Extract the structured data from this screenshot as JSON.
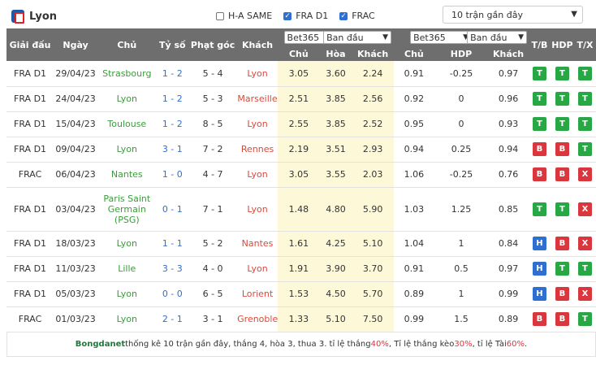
{
  "team": {
    "name": "Lyon"
  },
  "filters": [
    {
      "label": "H-A SAME",
      "checked": false
    },
    {
      "label": "FRA D1",
      "checked": true
    },
    {
      "label": "FRAC",
      "checked": true
    }
  ],
  "recent_select": {
    "value": "10 trận gần đây"
  },
  "headers": {
    "league": "Giải đấu",
    "date": "Ngày",
    "home": "Chủ",
    "score": "Tỷ số",
    "corners": "Phạt góc",
    "away": "Khách",
    "bookmaker1": "Bet365",
    "type1": "Ban đầu",
    "bookmaker2": "Bet365",
    "type2": "Ban đầu",
    "tb": "T/B",
    "hdp": "HDP",
    "tx": "T/X",
    "sub": [
      "Chủ",
      "Hòa",
      "Khách",
      "Chủ",
      "HDP",
      "Khách"
    ]
  },
  "matches": [
    {
      "league": "FRA D1",
      "date": "29/04/23",
      "home": "Strasbourg",
      "score": "1 - 2",
      "corners": "5 - 4",
      "away": "Lyon",
      "o_home": "3.05",
      "o_draw": "3.60",
      "o_away": "2.24",
      "h_home": "0.91",
      "h_line": "-0.25",
      "h_away": "0.97",
      "tb": "T",
      "hdp": "T",
      "tx": "T",
      "tb_c": "green",
      "hdp_c": "green",
      "tx_c": "green",
      "lyon_home": false
    },
    {
      "league": "FRA D1",
      "date": "24/04/23",
      "home": "Lyon",
      "score": "1 - 2",
      "corners": "5 - 3",
      "away": "Marseille",
      "o_home": "2.51",
      "o_draw": "3.85",
      "o_away": "2.56",
      "h_home": "0.92",
      "h_line": "0",
      "h_away": "0.96",
      "tb": "T",
      "hdp": "T",
      "tx": "T",
      "tb_c": "green",
      "hdp_c": "green",
      "tx_c": "green",
      "lyon_home": true
    },
    {
      "league": "FRA D1",
      "date": "15/04/23",
      "home": "Toulouse",
      "score": "1 - 2",
      "corners": "8 - 5",
      "away": "Lyon",
      "o_home": "2.55",
      "o_draw": "3.85",
      "o_away": "2.52",
      "h_home": "0.95",
      "h_line": "0",
      "h_away": "0.93",
      "tb": "T",
      "hdp": "T",
      "tx": "T",
      "tb_c": "green",
      "hdp_c": "green",
      "tx_c": "green",
      "lyon_home": false
    },
    {
      "league": "FRA D1",
      "date": "09/04/23",
      "home": "Lyon",
      "score": "3 - 1",
      "corners": "7 - 2",
      "away": "Rennes",
      "o_home": "2.19",
      "o_draw": "3.51",
      "o_away": "2.93",
      "h_home": "0.94",
      "h_line": "0.25",
      "h_away": "0.94",
      "tb": "B",
      "hdp": "B",
      "tx": "T",
      "tb_c": "red",
      "hdp_c": "red",
      "tx_c": "green",
      "lyon_home": true
    },
    {
      "league": "FRAC",
      "date": "06/04/23",
      "home": "Nantes",
      "score": "1 - 0",
      "corners": "4 - 7",
      "away": "Lyon",
      "o_home": "3.05",
      "o_draw": "3.55",
      "o_away": "2.03",
      "h_home": "1.06",
      "h_line": "-0.25",
      "h_away": "0.76",
      "tb": "B",
      "hdp": "B",
      "tx": "X",
      "tb_c": "red",
      "hdp_c": "red",
      "tx_c": "red",
      "lyon_home": false
    },
    {
      "league": "FRA D1",
      "date": "03/04/23",
      "home": "Paris Saint Germain (PSG)",
      "score": "0 - 1",
      "corners": "7 - 1",
      "away": "Lyon",
      "o_home": "1.48",
      "o_draw": "4.80",
      "o_away": "5.90",
      "h_home": "1.03",
      "h_line": "1.25",
      "h_away": "0.85",
      "tb": "T",
      "hdp": "T",
      "tx": "X",
      "tb_c": "green",
      "hdp_c": "green",
      "tx_c": "red",
      "lyon_home": false,
      "tall": true
    },
    {
      "league": "FRA D1",
      "date": "18/03/23",
      "home": "Lyon",
      "score": "1 - 1",
      "corners": "5 - 2",
      "away": "Nantes",
      "o_home": "1.61",
      "o_draw": "4.25",
      "o_away": "5.10",
      "h_home": "1.04",
      "h_line": "1",
      "h_away": "0.84",
      "tb": "H",
      "hdp": "B",
      "tx": "X",
      "tb_c": "blue",
      "hdp_c": "red",
      "tx_c": "red",
      "lyon_home": true
    },
    {
      "league": "FRA D1",
      "date": "11/03/23",
      "home": "Lille",
      "score": "3 - 3",
      "corners": "4 - 0",
      "away": "Lyon",
      "o_home": "1.91",
      "o_draw": "3.90",
      "o_away": "3.70",
      "h_home": "0.91",
      "h_line": "0.5",
      "h_away": "0.97",
      "tb": "H",
      "hdp": "T",
      "tx": "T",
      "tb_c": "blue",
      "hdp_c": "green",
      "tx_c": "green",
      "lyon_home": false
    },
    {
      "league": "FRA D1",
      "date": "05/03/23",
      "home": "Lyon",
      "score": "0 - 0",
      "corners": "6 - 5",
      "away": "Lorient",
      "o_home": "1.53",
      "o_draw": "4.50",
      "o_away": "5.70",
      "h_home": "0.89",
      "h_line": "1",
      "h_away": "0.99",
      "tb": "H",
      "hdp": "B",
      "tx": "X",
      "tb_c": "blue",
      "hdp_c": "red",
      "tx_c": "red",
      "lyon_home": true
    },
    {
      "league": "FRAC",
      "date": "01/03/23",
      "home": "Lyon",
      "score": "2 - 1",
      "corners": "3 - 1",
      "away": "Grenoble",
      "o_home": "1.33",
      "o_draw": "5.10",
      "o_away": "7.50",
      "h_home": "0.99",
      "h_line": "1.5",
      "h_away": "0.89",
      "tb": "B",
      "hdp": "B",
      "tx": "T",
      "tb_c": "red",
      "hdp_c": "red",
      "tx_c": "green",
      "lyon_home": true
    }
  ],
  "footer": {
    "brand": "Bongdanet",
    "text1": " thống kê 10 trận gần đây, thắng 4, hòa 3, thua 3. tỉ lệ thắng ",
    "win_pct": "40%",
    "text2": ", Tỉ lệ thắng kèo ",
    "hdp_pct": "30%",
    "text3": ", tỉ lệ Tài ",
    "over_pct": "60%",
    "text4": "."
  },
  "colors": {
    "header_bg": "#6e6e6e",
    "green": "#28a745",
    "red": "#d9363e",
    "blue": "#2e6fd1",
    "highlight": "#fdf8d8"
  }
}
